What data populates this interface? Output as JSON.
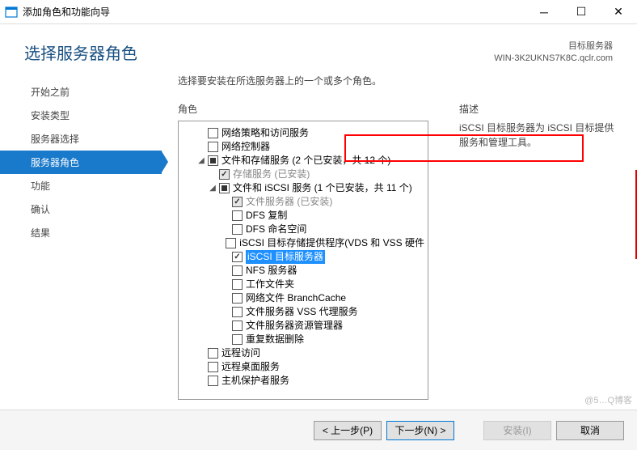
{
  "window": {
    "title": "添加角色和功能向导"
  },
  "header": {
    "pageTitle": "选择服务器角色",
    "targetLabel": "目标服务器",
    "targetServer": "WIN-3K2UKNS7K8C.qclr.com"
  },
  "nav": {
    "items": [
      {
        "label": "开始之前",
        "active": false
      },
      {
        "label": "安装类型",
        "active": false
      },
      {
        "label": "服务器选择",
        "active": false
      },
      {
        "label": "服务器角色",
        "active": true
      },
      {
        "label": "功能",
        "active": false
      },
      {
        "label": "确认",
        "active": false
      },
      {
        "label": "结果",
        "active": false
      }
    ]
  },
  "main": {
    "instruction": "选择要安装在所选服务器上的一个或多个角色。",
    "rolesLabel": "角色",
    "descLabel": "描述",
    "descText": "iSCSI 目标服务器为 iSCSI 目标提供服务和管理工具。"
  },
  "tree": [
    {
      "level": 1,
      "expander": "none",
      "check": "empty",
      "label": "网络策略和访问服务"
    },
    {
      "level": 1,
      "expander": "none",
      "check": "empty",
      "label": "网络控制器"
    },
    {
      "level": 1,
      "expander": "expanded",
      "check": "partial",
      "label": "文件和存储服务 (2 个已安装，共 12 个)"
    },
    {
      "level": 2,
      "expander": "none",
      "check": "checked-disabled",
      "label": "存储服务 (已安装)",
      "disabled": true
    },
    {
      "level": 2,
      "expander": "expanded",
      "check": "partial",
      "label": "文件和 iSCSI 服务 (1 个已安装，共 11 个)"
    },
    {
      "level": 3,
      "expander": "none",
      "check": "checked-disabled",
      "label": "文件服务器 (已安装)",
      "disabled": true
    },
    {
      "level": 3,
      "expander": "none",
      "check": "empty",
      "label": "DFS 复制"
    },
    {
      "level": 3,
      "expander": "none",
      "check": "empty",
      "label": "DFS 命名空间"
    },
    {
      "level": 3,
      "expander": "none",
      "check": "empty",
      "label": "iSCSI 目标存储提供程序(VDS 和 VSS 硬件"
    },
    {
      "level": 3,
      "expander": "none",
      "check": "checked",
      "label": "iSCSI 目标服务器",
      "selected": true
    },
    {
      "level": 3,
      "expander": "none",
      "check": "empty",
      "label": "NFS 服务器"
    },
    {
      "level": 3,
      "expander": "none",
      "check": "empty",
      "label": "工作文件夹"
    },
    {
      "level": 3,
      "expander": "none",
      "check": "empty",
      "label": "网络文件 BranchCache"
    },
    {
      "level": 3,
      "expander": "none",
      "check": "empty",
      "label": "文件服务器 VSS 代理服务"
    },
    {
      "level": 3,
      "expander": "none",
      "check": "empty",
      "label": "文件服务器资源管理器"
    },
    {
      "level": 3,
      "expander": "none",
      "check": "empty",
      "label": "重复数据删除"
    },
    {
      "level": 1,
      "expander": "none",
      "check": "empty",
      "label": "远程访问"
    },
    {
      "level": 1,
      "expander": "none",
      "check": "empty",
      "label": "远程桌面服务"
    },
    {
      "level": 1,
      "expander": "none",
      "check": "empty",
      "label": "主机保护者服务"
    }
  ],
  "footer": {
    "prev": "< 上一步(P)",
    "next": "下一步(N) >",
    "install": "安装(I)",
    "cancel": "取消"
  },
  "watermark": "@5…Q博客"
}
